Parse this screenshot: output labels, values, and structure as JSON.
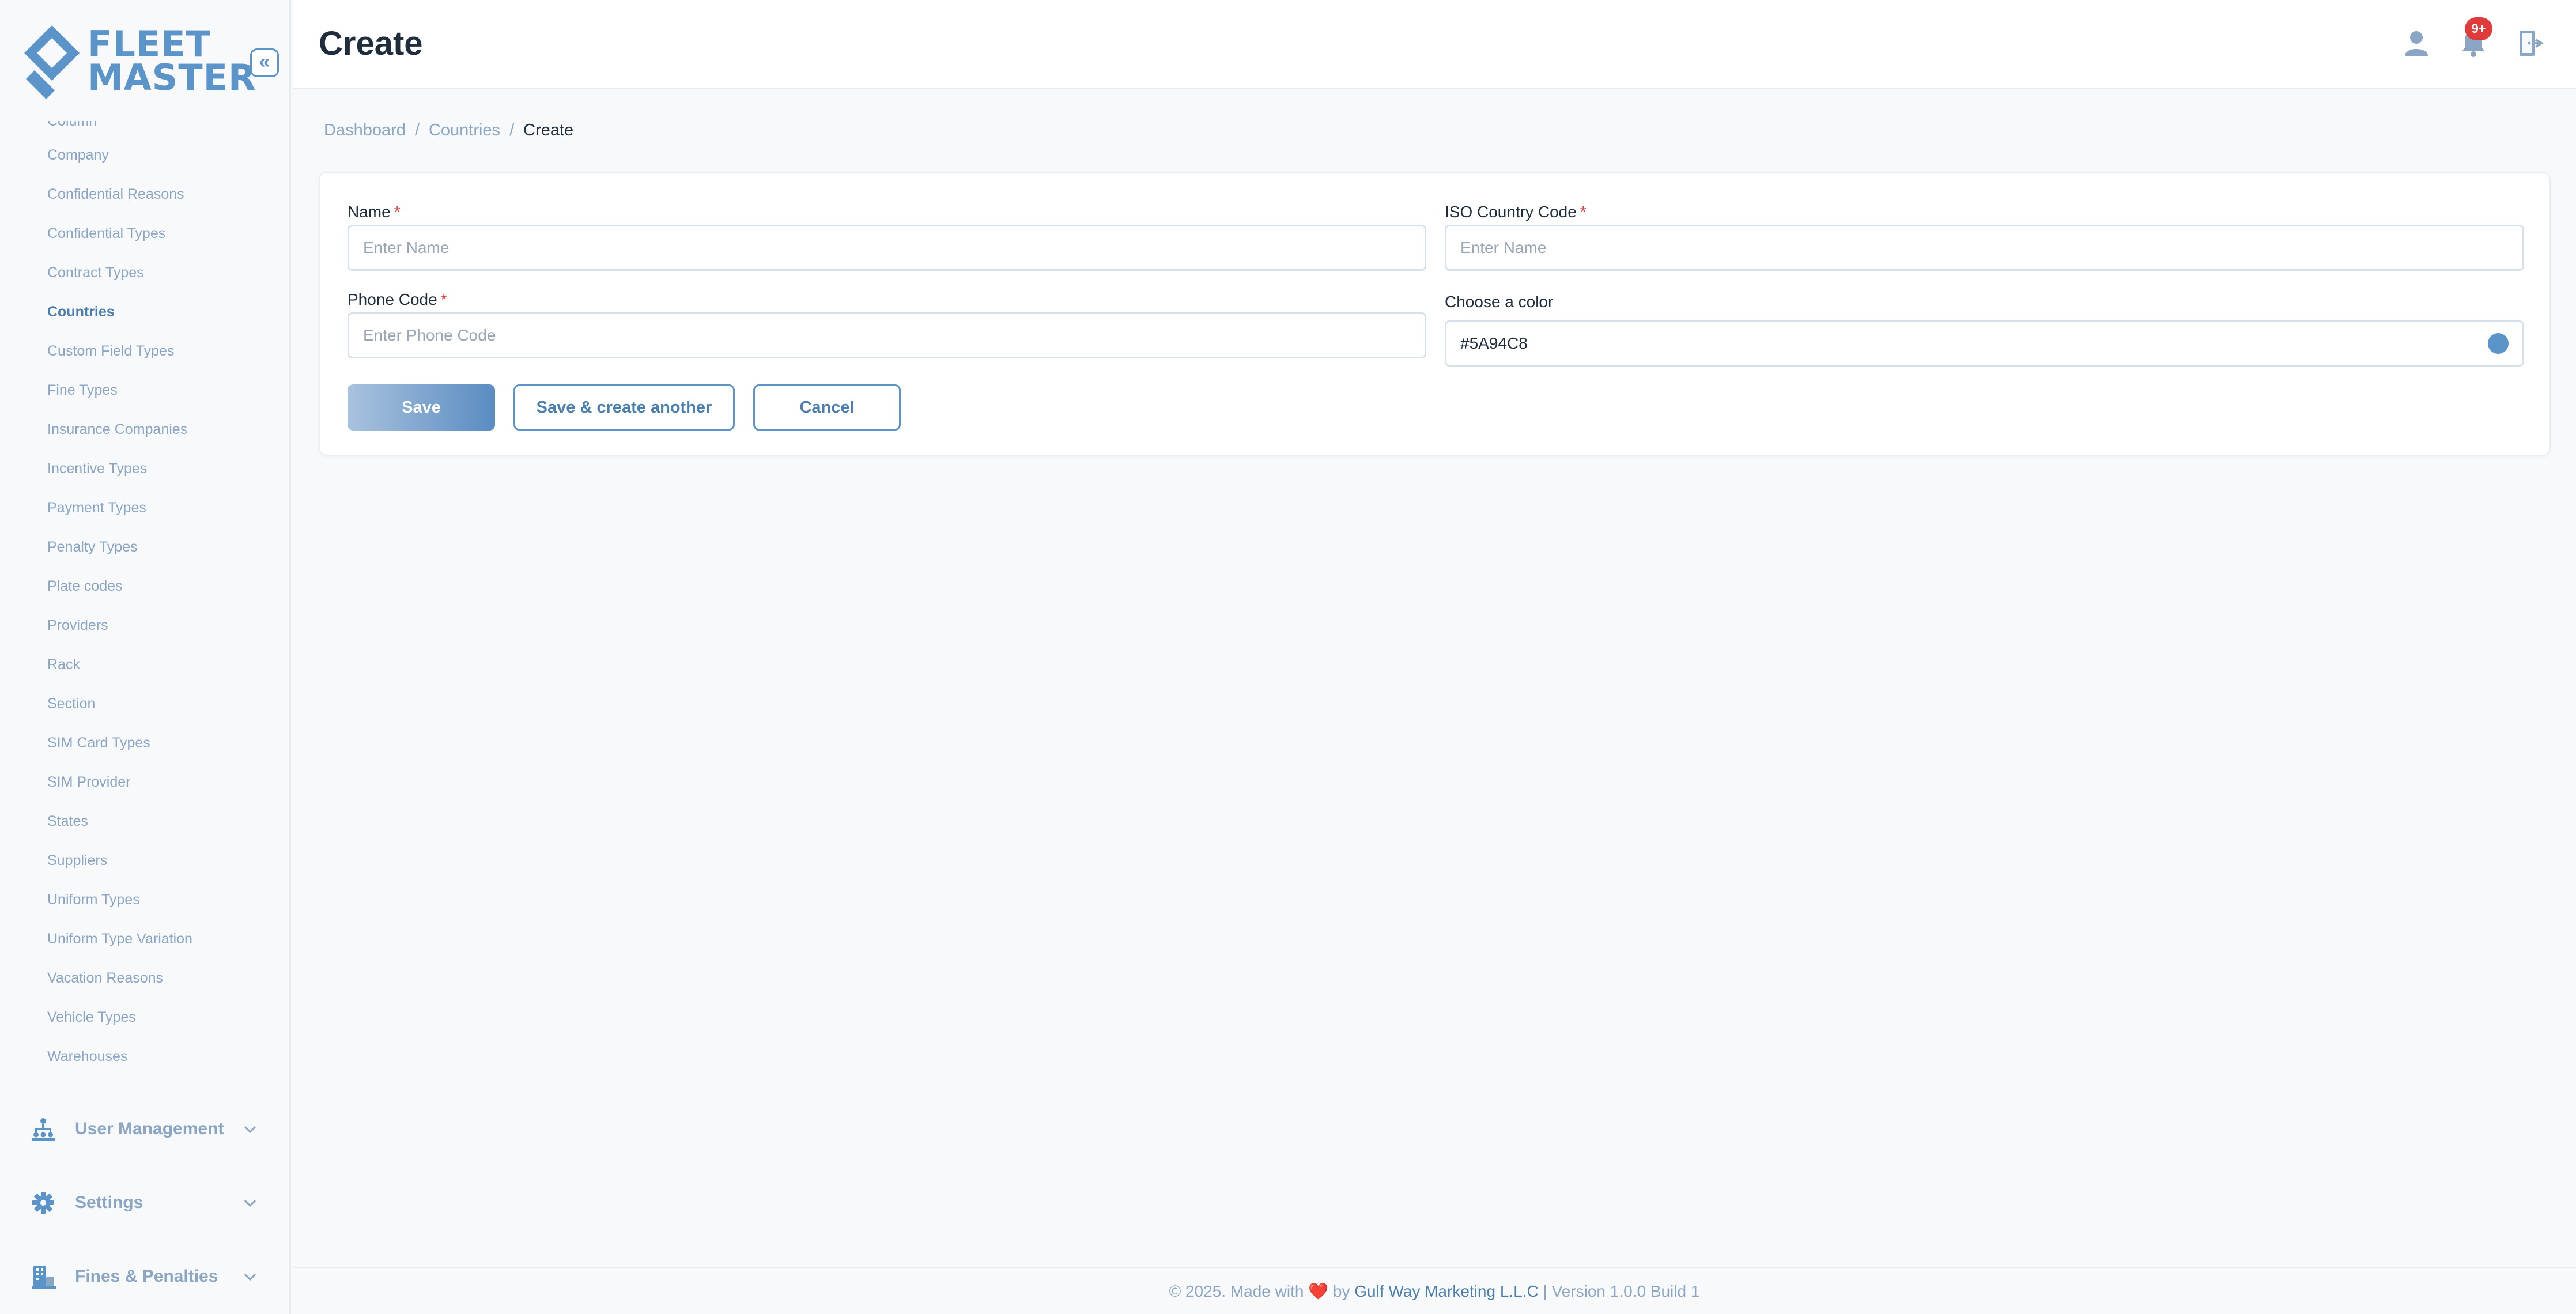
{
  "brand": {
    "line1": "FLEET",
    "line2": "MASTER",
    "color": "#5a94c8"
  },
  "sidebar": {
    "collapse_glyph": "«",
    "items": [
      {
        "label": "Column",
        "state": "partially-visible"
      },
      {
        "label": "Company"
      },
      {
        "label": "Confidential Reasons"
      },
      {
        "label": "Confidential Types"
      },
      {
        "label": "Contract Types"
      },
      {
        "label": "Countries",
        "active": true
      },
      {
        "label": "Custom Field Types"
      },
      {
        "label": "Fine Types"
      },
      {
        "label": "Insurance Companies"
      },
      {
        "label": "Incentive Types"
      },
      {
        "label": "Payment Types"
      },
      {
        "label": "Penalty Types"
      },
      {
        "label": "Plate codes"
      },
      {
        "label": "Providers"
      },
      {
        "label": "Rack"
      },
      {
        "label": "Section"
      },
      {
        "label": "SIM Card Types"
      },
      {
        "label": "SIM Provider"
      },
      {
        "label": "States"
      },
      {
        "label": "Suppliers"
      },
      {
        "label": "Uniform Types"
      },
      {
        "label": "Uniform Type Variation"
      },
      {
        "label": "Vacation Reasons"
      },
      {
        "label": "Vehicle Types"
      },
      {
        "label": "Warehouses"
      }
    ],
    "groups": [
      {
        "label": "User Management",
        "icon": "hierarchy-icon"
      },
      {
        "label": "Settings",
        "icon": "gear-icon"
      },
      {
        "label": "Fines & Penalties",
        "icon": "building-icon"
      }
    ]
  },
  "header": {
    "title": "Create",
    "notification_badge": "9+",
    "icons": [
      "user-icon",
      "bell-icon",
      "logout-icon"
    ]
  },
  "breadcrumb": {
    "items": [
      "Dashboard",
      "Countries"
    ],
    "current": "Create",
    "separator": "/"
  },
  "form": {
    "name": {
      "label": "Name",
      "required_mark": "*",
      "placeholder": "Enter Name",
      "value": ""
    },
    "iso": {
      "label": "ISO Country Code",
      "required_mark": "*",
      "placeholder": "Enter Name",
      "value": ""
    },
    "phone": {
      "label": "Phone Code",
      "required_mark": "*",
      "placeholder": "Enter Phone Code",
      "value": ""
    },
    "color": {
      "label": "Choose a color",
      "value": "#5A94C8"
    }
  },
  "buttons": {
    "save": "Save",
    "save_another": "Save & create another",
    "cancel": "Cancel"
  },
  "footer": {
    "prefix": "© 2025. Made with",
    "heart": "❤️",
    "by": "by",
    "company": "Gulf Way Marketing L.L.C",
    "suffix": "| Version 1.0.0 Build 1"
  }
}
